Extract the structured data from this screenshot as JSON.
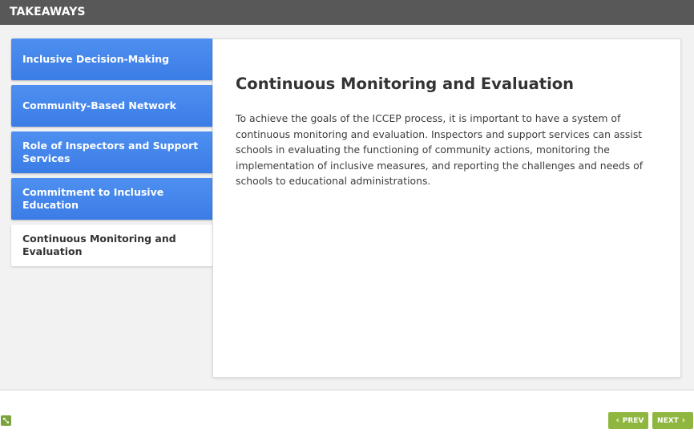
{
  "header": {
    "title": "TAKEAWAYS"
  },
  "tabs": [
    {
      "label": "Inclusive Decision-Making"
    },
    {
      "label": "Community-Based Network"
    },
    {
      "label": "Role of Inspectors and Support Services"
    },
    {
      "label": "Commitment to Inclusive Education"
    },
    {
      "label": "Continuous Monitoring and Evaluation",
      "active": true
    }
  ],
  "content": {
    "title": "Continuous Monitoring and Evaluation",
    "body": "To achieve the goals of the ICCEP process, it is important to have a system of continuous monitoring and evaluation. Inspectors and support services can assist schools in evaluating the functioning of community actions, monitoring the implementation of inclusive measures, and reporting the challenges and needs of schools to educational administrations."
  },
  "footer": {
    "prev_label": "PREV",
    "next_label": "NEXT",
    "expand_icon": "expand-icon",
    "prev_icon": "chevron-left-icon",
    "next_icon": "chevron-right-icon"
  },
  "colors": {
    "header_bg": "#585858",
    "tab_blue": "#3b7de6",
    "nav_green": "#8fb63e"
  }
}
